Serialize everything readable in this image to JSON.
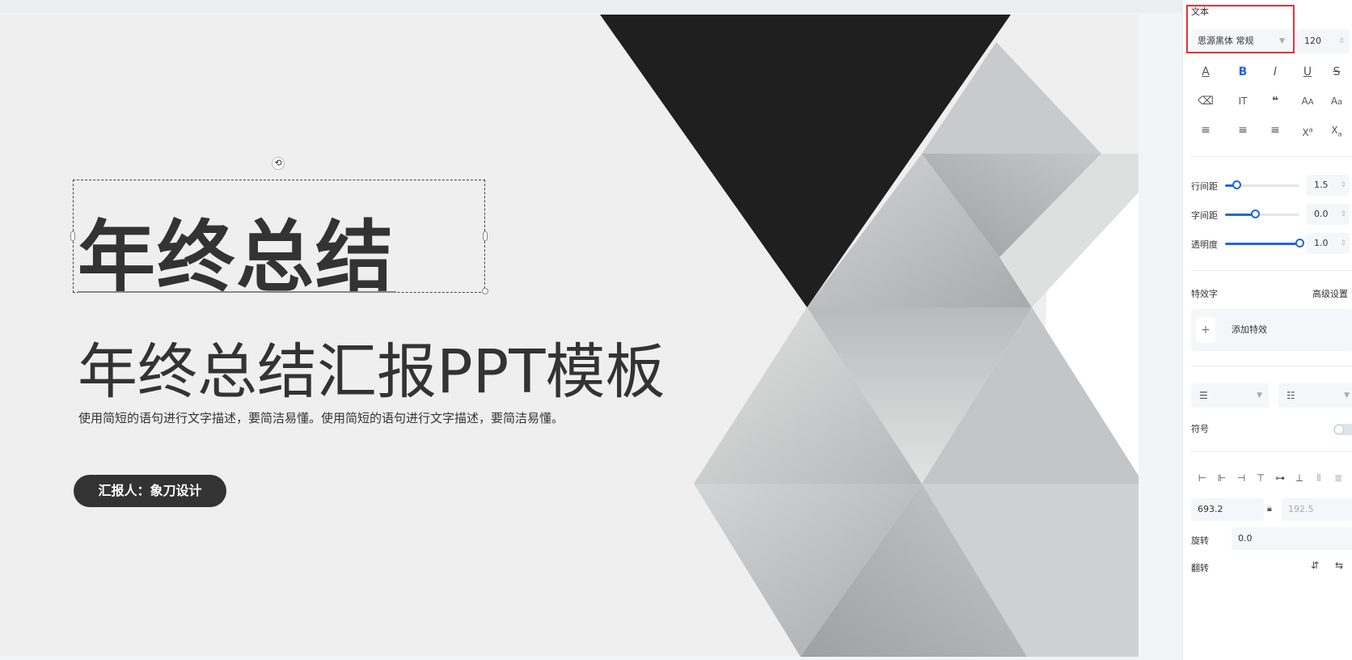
{
  "slide": {
    "title": "年终总结",
    "subtitle": "年终总结汇报PPT模板",
    "description": "使用简短的语句进行文字描述，要简洁易懂。使用简短的语句进行文字描述，要简洁易懂。",
    "reporter": "汇报人：象刀设计"
  },
  "panel": {
    "section_text": "文本",
    "font_name": "思源黑体 常规",
    "font_size": "120",
    "line_spacing_label": "行间距",
    "line_spacing_value": "1.5",
    "line_spacing_level": 0.15,
    "char_spacing_label": "字间距",
    "char_spacing_value": "0.0",
    "char_spacing_level": 0.4,
    "opacity_label": "透明度",
    "opacity_value": "1.0",
    "opacity_level": 1.0,
    "effects_label": "特效字",
    "advanced_label": "高级设置",
    "add_effect_label": "添加特效",
    "bullet_label": "符号",
    "pos_x": "693.2",
    "pos_y": "192.5",
    "rotate_label": "旋转",
    "rotate_value": "0.0",
    "flip_label": "翻转"
  },
  "colors": {
    "highlight": "#e5323a",
    "accent": "#2266dd",
    "dark": "#333333"
  }
}
